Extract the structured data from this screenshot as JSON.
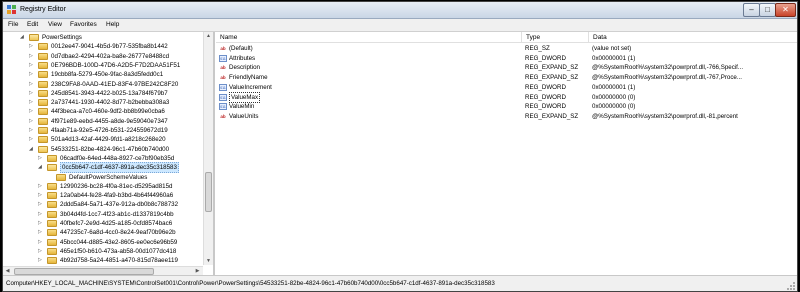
{
  "window": {
    "title": "Registry Editor"
  },
  "menu": [
    "File",
    "Edit",
    "View",
    "Favorites",
    "Help"
  ],
  "tree": {
    "rows": [
      {
        "label": "PowerSettings",
        "expander": "◢",
        "open": true
      },
      {
        "label": "0012ee47-9041-4b5d-9b77-535fba8b1442",
        "expander": "▷"
      },
      {
        "label": "0d7dbae2-4294-402a-ba8e-26777e8488cd",
        "expander": "▷"
      },
      {
        "label": "0E796BDB-100D-47D6-A2D5-F7D2DAA51F51",
        "expander": "▷"
      },
      {
        "label": "19cbb8fa-5279-450e-9fac-8a3d5fedd0c1",
        "expander": "▷"
      },
      {
        "label": "238C9FA8-0AAD-41ED-83F4-97BE242C8F20",
        "expander": "▷"
      },
      {
        "label": "245d8541-3943-4422-b025-13a784f679b7",
        "expander": "▷"
      },
      {
        "label": "2a737441-1930-4402-8d77-b2bebba308a3",
        "expander": "▷"
      },
      {
        "label": "44f3beca-a7c0-460e-9df2-bb8b99e0cba6",
        "expander": "▷"
      },
      {
        "label": "4f971e89-eebd-4455-a8de-9e59040e7347",
        "expander": "▷"
      },
      {
        "label": "4faab71a-92e5-4726-b531-224559672d19",
        "expander": "▷"
      },
      {
        "label": "501a4d13-42af-4429-9fd1-a8218c268e20",
        "expander": "▷"
      },
      {
        "label": "54533251-82be-4824-96c1-47b60b740d00",
        "expander": "◢",
        "open": true
      },
      {
        "label": "06cadf0e-64ed-448a-8927-ce7bf90eb35d",
        "expander": "▷"
      },
      {
        "label": "0cc5b647-c1df-4637-891a-dec35c318583",
        "expander": "◢",
        "open": true,
        "selected": true
      },
      {
        "label": "DefaultPowerSchemeValues",
        "expander": ""
      },
      {
        "label": "12990236-bc28-4f0a-81ec-d5295ad815d",
        "expander": "▷"
      },
      {
        "label": "12a0ab44-fe28-4fa9-b3bd-4b64f44960a6",
        "expander": "▷"
      },
      {
        "label": "2ddd5a84-5a71-437e-912a-db0b8c788732",
        "expander": "▷"
      },
      {
        "label": "3b04d4fd-1cc7-4f23-ab1c-d1337819c4bb",
        "expander": "▷"
      },
      {
        "label": "40fbefc7-2e9d-4d25-a185-0cfd8574bac6",
        "expander": "▷"
      },
      {
        "label": "447235c7-6a8d-4cc0-8e24-9eaf70b96e2b",
        "expander": "▷"
      },
      {
        "label": "45bcc044-d885-43e2-8605-ee0ec6e96b59",
        "expander": "▷"
      },
      {
        "label": "465e1f50-b610-473a-ab58-00d1077dc418",
        "expander": "▷"
      },
      {
        "label": "4b92d758-5a24-4851-a470-815d78aee119",
        "expander": "▷"
      }
    ]
  },
  "values": {
    "columns": {
      "name": "Name",
      "type": "Type",
      "data": "Data"
    },
    "rows": [
      {
        "icon": "ab",
        "name": "(Default)",
        "type": "REG_SZ",
        "data": "(value not set)"
      },
      {
        "icon": "bin",
        "name": "Attributes",
        "type": "REG_DWORD",
        "data": "0x00000001 (1)"
      },
      {
        "icon": "ab",
        "name": "Description",
        "type": "REG_EXPAND_SZ",
        "data": "@%SystemRoot%\\system32\\powrprof.dll,-766,Specif..."
      },
      {
        "icon": "ab",
        "name": "FriendlyName",
        "type": "REG_EXPAND_SZ",
        "data": "@%SystemRoot%\\system32\\powrprof.dll,-767,Proce..."
      },
      {
        "icon": "bin",
        "name": "ValueIncrement",
        "type": "REG_DWORD",
        "data": "0x00000001 (1)"
      },
      {
        "icon": "bin",
        "name": "ValueMax",
        "type": "REG_DWORD",
        "data": "0x00000000 (0)",
        "selected": true
      },
      {
        "icon": "bin",
        "name": "ValueMin",
        "type": "REG_DWORD",
        "data": "0x00000000 (0)"
      },
      {
        "icon": "ab",
        "name": "ValueUnits",
        "type": "REG_EXPAND_SZ",
        "data": "@%SystemRoot%\\system32\\powrprof.dll,-81,percent"
      }
    ]
  },
  "status": "Computer\\HKEY_LOCAL_MACHINE\\SYSTEM\\ControlSet001\\Control\\Power\\PowerSettings\\54533251-82be-4824-96c1-47b60b740d00\\0cc5b647-c1df-4637-891a-dec35c318583"
}
